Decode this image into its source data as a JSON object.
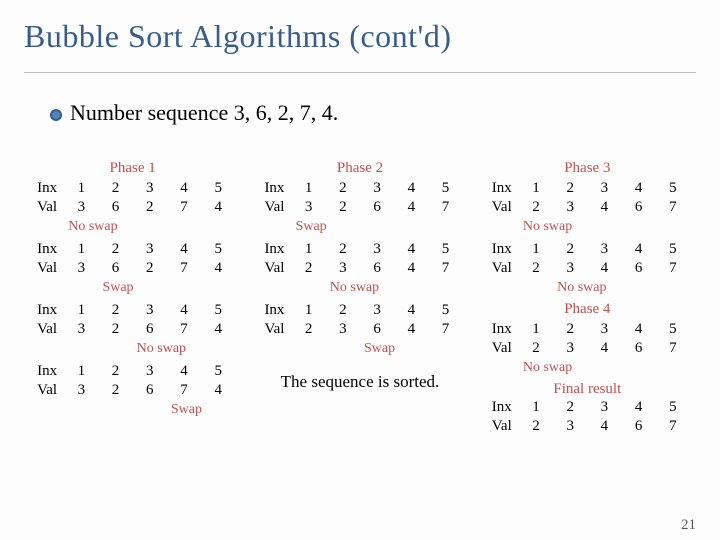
{
  "title": "Bubble Sort Algorithms (cont'd)",
  "bullet": "Number sequence 3, 6, 2, 7, 4.",
  "labels": {
    "inx": "Inx",
    "val": "Val",
    "phase": "Phase",
    "noswap": "No swap",
    "swap": "Swap",
    "final": "Final result",
    "sorted": "The sequence is sorted."
  },
  "col1": [
    {
      "phase": "Phase 1"
    },
    {
      "inx": [
        1,
        2,
        3,
        4,
        5
      ],
      "val": [
        3,
        6,
        2,
        7,
        4
      ],
      "note": "No swap",
      "arc": [
        0,
        1
      ]
    },
    {
      "inx": [
        1,
        2,
        3,
        4,
        5
      ],
      "val": [
        3,
        6,
        2,
        7,
        4
      ],
      "note": "Swap",
      "arc": [
        1,
        2
      ]
    },
    {
      "inx": [
        1,
        2,
        3,
        4,
        5
      ],
      "val": [
        3,
        2,
        6,
        7,
        4
      ],
      "note": "No swap",
      "arc": [
        2,
        3
      ]
    },
    {
      "inx": [
        1,
        2,
        3,
        4,
        5
      ],
      "val": [
        3,
        2,
        6,
        7,
        4
      ],
      "note": "Swap",
      "arc": [
        3,
        4
      ]
    }
  ],
  "col2": [
    {
      "phase": "Phase 2"
    },
    {
      "inx": [
        1,
        2,
        3,
        4,
        5
      ],
      "val": [
        3,
        2,
        6,
        4,
        7
      ],
      "note": "Swap",
      "arc": [
        0,
        1
      ]
    },
    {
      "inx": [
        1,
        2,
        3,
        4,
        5
      ],
      "val": [
        2,
        3,
        6,
        4,
        7
      ],
      "note": "No swap",
      "arc": [
        1,
        2
      ]
    },
    {
      "inx": [
        1,
        2,
        3,
        4,
        5
      ],
      "val": [
        2,
        3,
        6,
        4,
        7
      ],
      "note": "Swap",
      "arc": [
        2,
        3
      ]
    }
  ],
  "col3": [
    {
      "phase": "Phase 3"
    },
    {
      "inx": [
        1,
        2,
        3,
        4,
        5
      ],
      "val": [
        2,
        3,
        4,
        6,
        7
      ],
      "note": "No swap",
      "arc": [
        0,
        1
      ]
    },
    {
      "inx": [
        1,
        2,
        3,
        4,
        5
      ],
      "val": [
        2,
        3,
        4,
        6,
        7
      ],
      "note": "No swap",
      "arc": [
        1,
        2
      ]
    },
    {
      "phase": "Phase 4"
    },
    {
      "inx": [
        1,
        2,
        3,
        4,
        5
      ],
      "val": [
        2,
        3,
        4,
        6,
        7
      ],
      "note": "No swap",
      "arc": [
        0,
        1
      ]
    },
    {
      "final": "Final result"
    },
    {
      "inx": [
        1,
        2,
        3,
        4,
        5
      ],
      "val": [
        2,
        3,
        4,
        6,
        7
      ]
    }
  ],
  "pagenum": "21"
}
